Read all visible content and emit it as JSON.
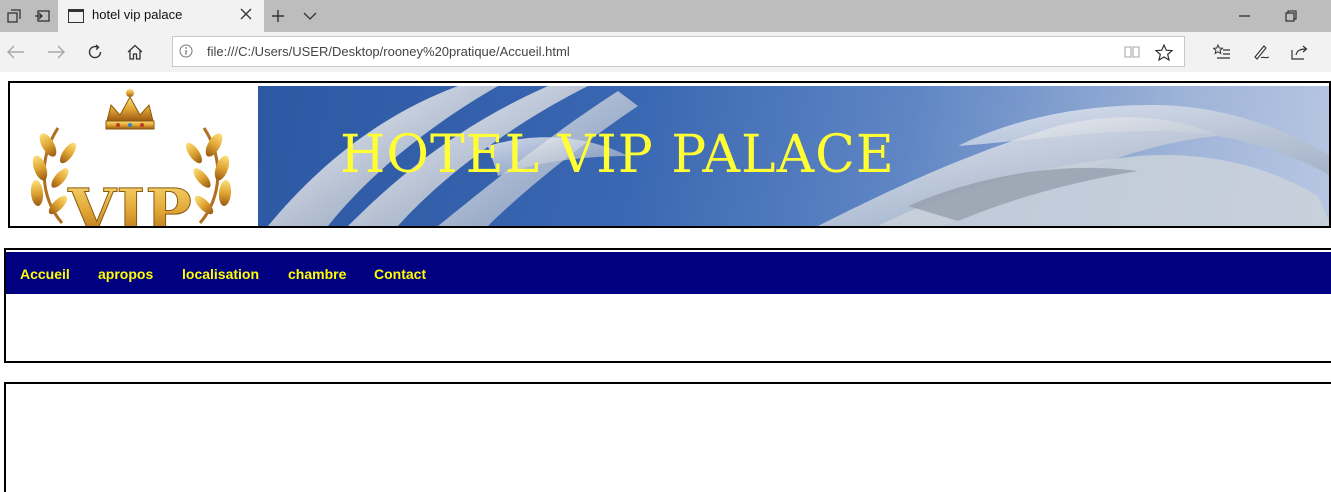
{
  "browser": {
    "tab_title": "hotel vip palace",
    "address": "file:///C:/Users/USER/Desktop/rooney%20pratique/Accueil.html"
  },
  "banner": {
    "logo_text": "VIP",
    "title": "HOTEL VIP PALACE"
  },
  "nav": {
    "items": [
      {
        "label": "Accueil"
      },
      {
        "label": "apropos"
      },
      {
        "label": "localisation"
      },
      {
        "label": "chambre"
      },
      {
        "label": "Contact"
      }
    ]
  },
  "colors": {
    "nav_background": "#000080",
    "nav_text": "#ffff00",
    "title_text": "#ffff33",
    "logo_gold": "#d99a2b"
  }
}
